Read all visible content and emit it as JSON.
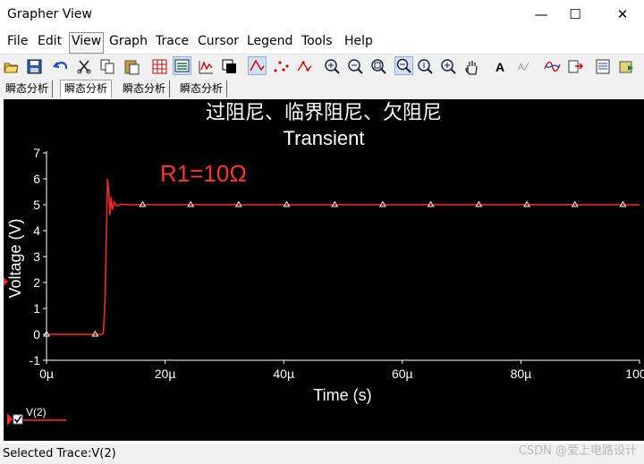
{
  "window": {
    "title": "Grapher View",
    "minimize": "—",
    "maximize": "☐",
    "close": "✕"
  },
  "menu": [
    "File",
    "Edit",
    "View",
    "Graph",
    "Trace",
    "Cursor",
    "Legend",
    "Tools",
    "Help"
  ],
  "toolbar_icons": [
    "open-icon",
    "save-icon",
    "undo-icon",
    "cut-icon",
    "copy-icon",
    "paste-icon",
    "grid-icon",
    "legend-icon",
    "chart-settings-icon",
    "reverse-colors-icon",
    "show-lines-icon",
    "show-markers-icon",
    "show-both-icon",
    "zoom-in-icon",
    "zoom-out-icon",
    "zoom-fit-icon",
    "zoom-x-icon",
    "zoom-y-icon",
    "zoom-area-icon",
    "pan-icon",
    "text-icon",
    "label-icon",
    "cursor-icon",
    "export-icon",
    "overlay-icon",
    "properties-icon"
  ],
  "tabs": [
    "瞬态分析",
    "瞬态分析",
    "瞬态分析",
    "瞬态分析"
  ],
  "status": {
    "selected_trace": "Selected Trace:V(2)",
    "watermark": "CSDN @爱上电路设计"
  },
  "chart_data": {
    "type": "line",
    "title": "过阻尼、临界阻尼、欠阻尼",
    "subtitle": "Transient",
    "annotation": "R1=10Ω",
    "xlabel": "Time (s)",
    "ylabel": "Voltage (V)",
    "xlim": [
      0,
      100
    ],
    "ylim": [
      -1,
      7
    ],
    "x_unit": "µs",
    "x_ticks": [
      0,
      20,
      40,
      60,
      80,
      100
    ],
    "x_tick_labels": [
      "0µ",
      "20µ",
      "40µ",
      "60µ",
      "80µ",
      "100µ"
    ],
    "y_ticks": [
      -1,
      0,
      1,
      2,
      3,
      4,
      5,
      6,
      7
    ],
    "y_tick_labels": [
      "-1",
      "0",
      "1",
      "2",
      "3",
      "4",
      "5",
      "6",
      "7"
    ],
    "series": [
      {
        "name": "V(2)",
        "color": "#ff2a2a",
        "x": [
          0,
          9.3,
          9.6,
          9.9,
          10.1,
          10.3,
          10.5,
          10.7,
          10.9,
          11.1,
          11.4,
          11.8,
          12.5,
          14,
          100
        ],
        "y": [
          0,
          0,
          0.05,
          1.5,
          4.0,
          6.0,
          5.5,
          4.6,
          5.3,
          4.8,
          5.1,
          4.95,
          5.02,
          5.0,
          5.0
        ],
        "marker_x": [
          0,
          8.2,
          16.2,
          24.3,
          32.4,
          40.5,
          48.6,
          56.7,
          64.8,
          72.9,
          81.0,
          89.1,
          97.2
        ],
        "marker_y": [
          0,
          0,
          5,
          5,
          5,
          5,
          5,
          5,
          5,
          5,
          5,
          5,
          5
        ]
      }
    ],
    "legend": {
      "position": "bottom-left",
      "entries": [
        "V(2)"
      ],
      "checked": true
    },
    "grid": false,
    "background": "#000000",
    "foreground": "#ffffff",
    "annotation_color": "#ff3333"
  }
}
